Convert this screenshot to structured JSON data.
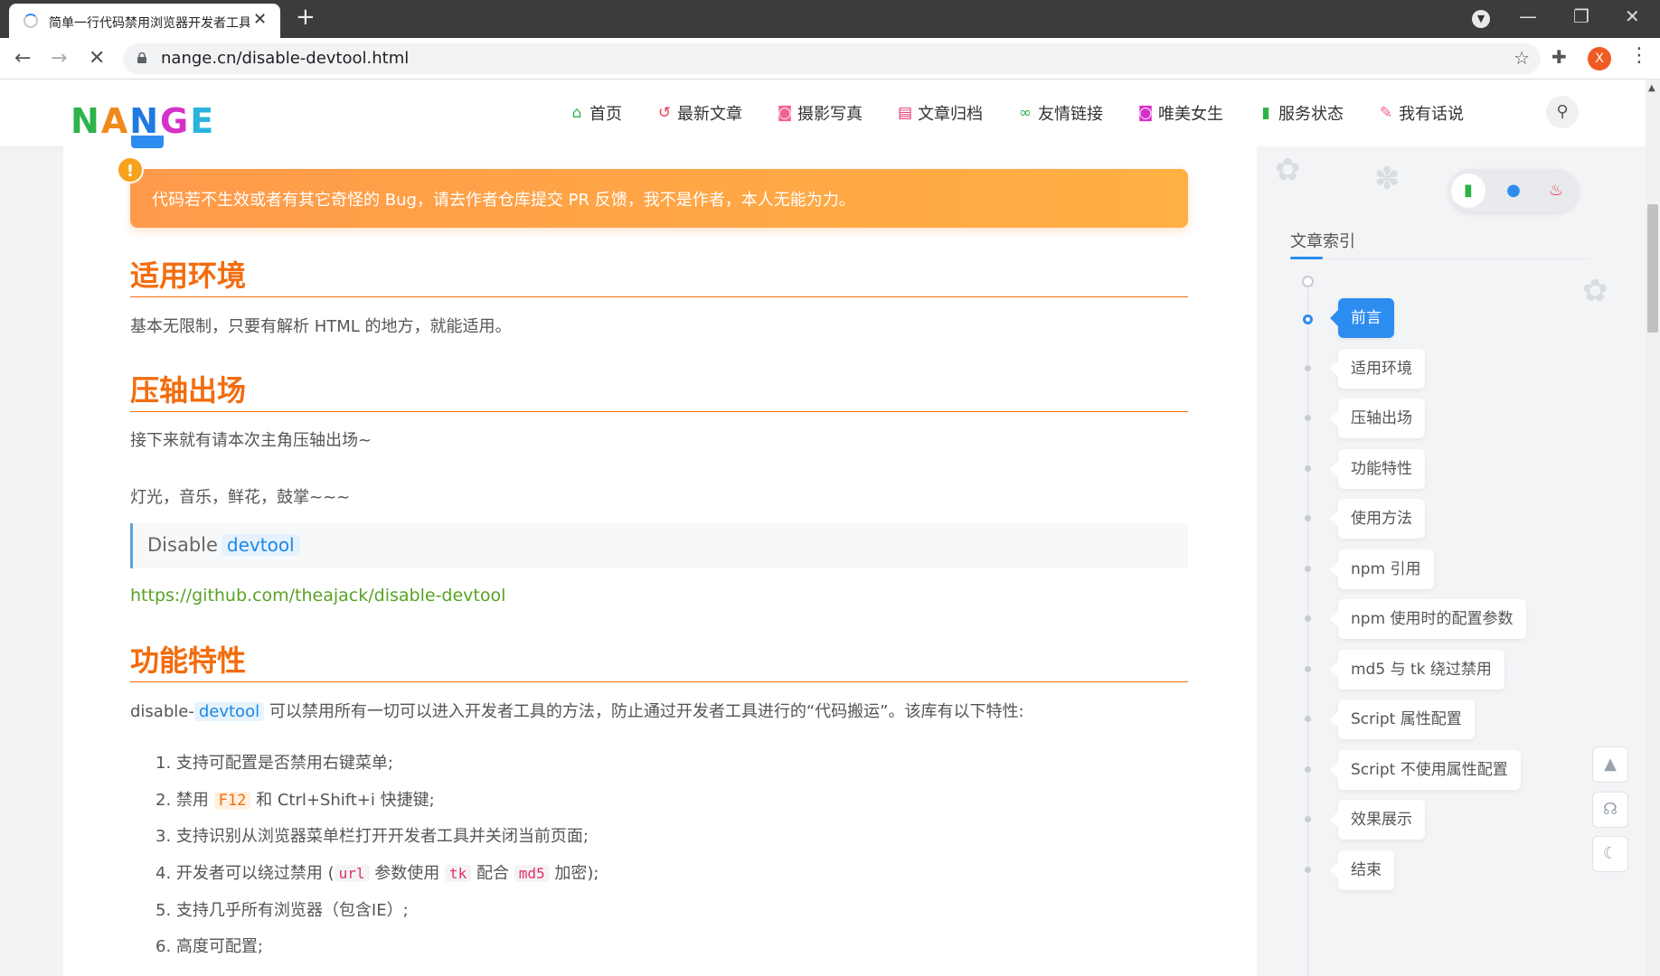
{
  "browser": {
    "tab_title": "简单一行代码禁用浏览器开发者工具",
    "new_tab": "+",
    "tab_close": "✕",
    "url": "nange.cn/disable-devtool.html",
    "avatar_letter": "X",
    "win_min": "—",
    "win_restore": "❐",
    "win_close": "✕",
    "back": "←",
    "forward": "→",
    "reload": "✕",
    "star": "☆",
    "menu": "⋮"
  },
  "header": {
    "logo_letters": [
      "N",
      "A",
      "N",
      "G",
      "E"
    ],
    "logo_colors": [
      "#2db34a",
      "#f08a1c",
      "#1f7ae0",
      "#d531c8",
      "#2ab3dd"
    ],
    "nav": [
      {
        "label": "首页",
        "icon": "home-icon",
        "glyph": "⌂",
        "color": "#2db34a"
      },
      {
        "label": "最新文章",
        "icon": "history-icon",
        "glyph": "↺",
        "color": "#e23e57"
      },
      {
        "label": "摄影写真",
        "icon": "camera-icon",
        "glyph": "◙",
        "color": "#f06292"
      },
      {
        "label": "文章归档",
        "icon": "archive-icon",
        "glyph": "▤",
        "color": "#e0306e"
      },
      {
        "label": "友情链接",
        "icon": "link-icon",
        "glyph": "∞",
        "color": "#2db34a"
      },
      {
        "label": "唯美女生",
        "icon": "camera-retro-icon",
        "glyph": "◙",
        "color": "#d531c8"
      },
      {
        "label": "服务状态",
        "icon": "signal-icon",
        "glyph": "▮",
        "color": "#2db34a"
      },
      {
        "label": "我有话说",
        "icon": "feather-icon",
        "glyph": "✎",
        "color": "#f06292"
      }
    ],
    "search_glyph": "⚲"
  },
  "article": {
    "warning_badge": "!",
    "warning": "代码若不生效或者有其它奇怪的 Bug，请去作者仓库提交 PR 反馈，我不是作者，本人无能为力。",
    "sections": [
      {
        "title": "适用环境"
      },
      {
        "title": "压轴出场"
      },
      {
        "title": "功能特性"
      }
    ],
    "p_env": "基本无限制，只要有解析 HTML 的地方，就能适用。",
    "p_intro1": "接下来就有请本次主角压轴出场~",
    "p_intro2": "灯光，音乐，鲜花，鼓掌~~~",
    "quote_prefix": "Disable",
    "quote_code": "devtool",
    "link": "https://github.com/theajack/disable-devtool",
    "feature_prefix": "disable-",
    "feature_code": "devtool",
    "feature_rest": "可以禁用所有一切可以进入开发者工具的方法，防止通过开发者工具进行的“代码搬运”。该库有以下特性:",
    "list": {
      "i1": "1. 支持可配置是否禁用右键菜单;",
      "i2_a": "2. 禁用",
      "i2_code": "F12",
      "i2_b": "和 Ctrl+Shift+i 快捷键;",
      "i3": "3. 支持识别从浏览器菜单栏打开开发者工具并关闭当前页面;",
      "i4_a": "4. 开发者可以绕过禁用 (",
      "i4_c1": "url",
      "i4_b": "参数使用",
      "i4_c2": "tk",
      "i4_c": "配合",
      "i4_c3": "md5",
      "i4_d": "加密);",
      "i5": "5. 支持几乎所有浏览器（包含IE）;",
      "i6": "6. 高度可配置;"
    }
  },
  "sidebar": {
    "toc_title": "文章索引",
    "toc": [
      "前言",
      "适用环境",
      "压轴出场",
      "功能特性",
      "使用方法",
      "npm 引用",
      "npm 使用时的配置参数",
      "md5 与 tk 绕过禁用",
      "Script 属性配置",
      "Script 不使用属性配置",
      "效果展示",
      "结束"
    ],
    "active_index": 0,
    "tools": [
      {
        "icon": "bookmark-icon",
        "glyph": "▮",
        "color": "#2db34a"
      },
      {
        "icon": "user-icon",
        "glyph": "●",
        "color": "#2d8cf0"
      },
      {
        "icon": "fire-icon",
        "glyph": "♨",
        "color": "#e23e57"
      }
    ],
    "side_buttons": [
      {
        "icon": "rocket-icon",
        "glyph": "▲"
      },
      {
        "icon": "headset-icon",
        "glyph": "☊"
      },
      {
        "icon": "moon-icon",
        "glyph": "☾"
      }
    ]
  }
}
